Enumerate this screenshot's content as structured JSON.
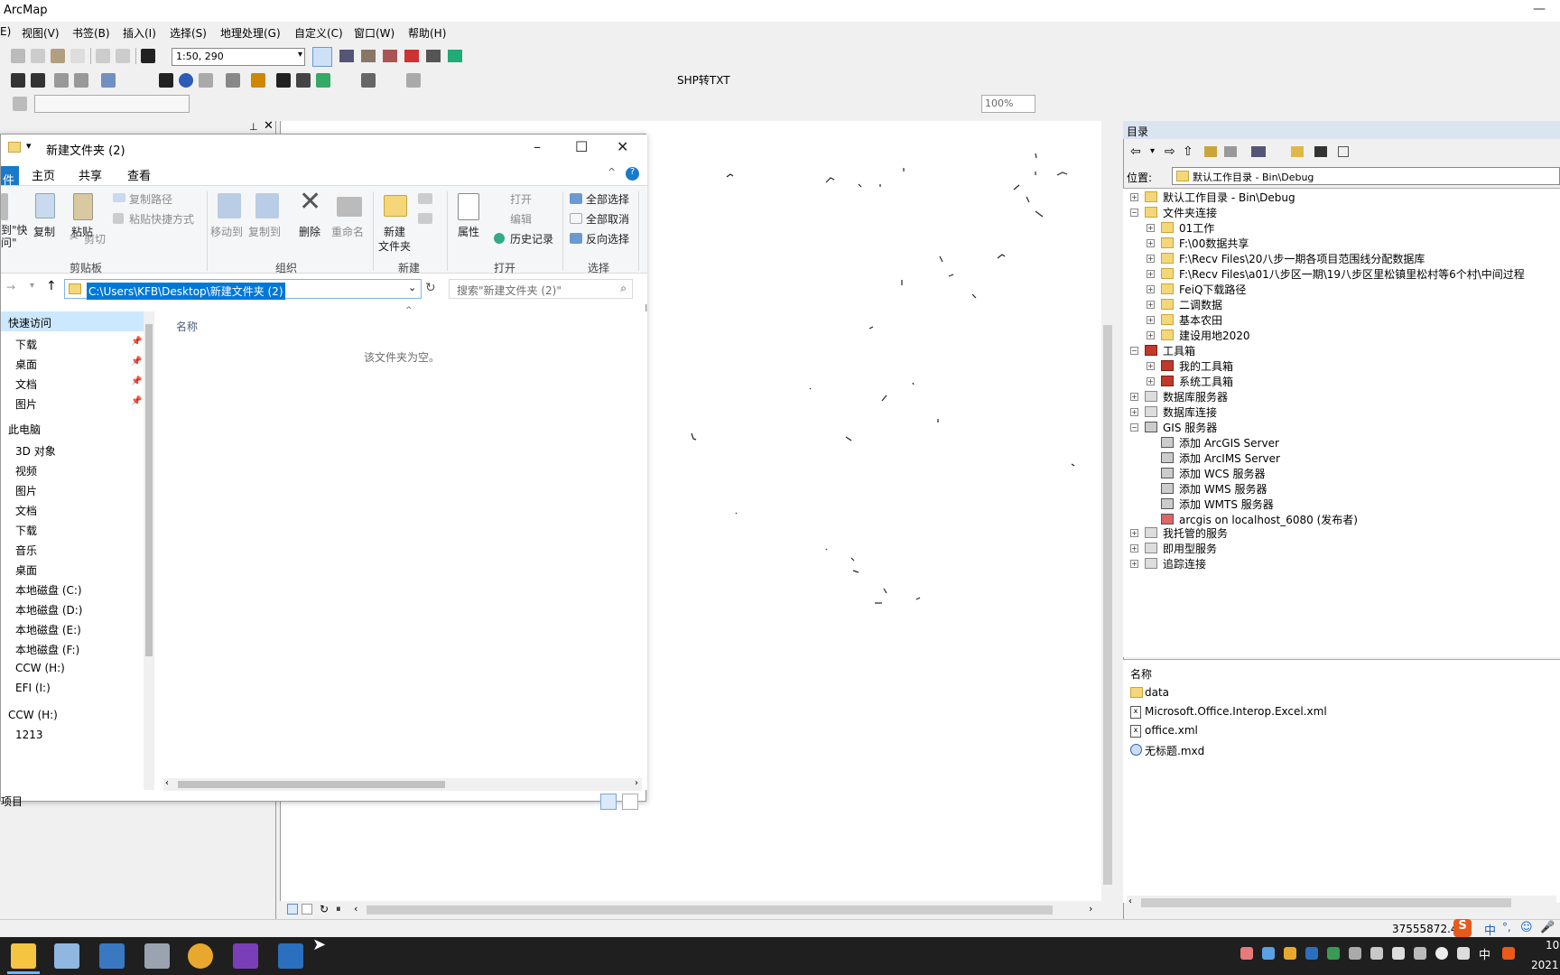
{
  "window": {
    "title": "ArcMap",
    "minimize_glyph": "—"
  },
  "menu": [
    {
      "label": "E)"
    },
    {
      "label": "视图(V)"
    },
    {
      "label": "书签(B)"
    },
    {
      "label": "插入(I)"
    },
    {
      "label": "选择(S)"
    },
    {
      "label": "地理处理(G)"
    },
    {
      "label": "自定义(C)"
    },
    {
      "label": "窗口(W)"
    },
    {
      "label": "帮助(H)"
    }
  ],
  "toolbar": {
    "scale_value": "1:50, 290",
    "shp_button_label": "SHP转TXT",
    "zoom_percent": "100%"
  },
  "explorer": {
    "title": "新建文件夹 (2)",
    "tabs": {
      "file": "件",
      "home": "主页",
      "share": "共享",
      "view": "查看"
    },
    "ribbon": {
      "pin_quick": "到\"快\n问\"",
      "copy": "复制",
      "paste": "粘贴",
      "copy_path": "复制路径",
      "paste_shortcut": "粘贴快捷方式",
      "cut": "剪切",
      "move_to": "移动到",
      "copy_to": "复制到",
      "delete": "删除",
      "rename": "重命名",
      "new_folder_l1": "新建",
      "new_folder_l2": "文件夹",
      "properties": "属性",
      "open": "打开",
      "edit": "编辑",
      "history": "历史记录",
      "select_all": "全部选择",
      "select_none": "全部取消",
      "invert_selection": "反向选择",
      "group_clipboard": "剪贴板",
      "group_organize": "组织",
      "group_new": "新建",
      "group_open": "打开",
      "group_select": "选择"
    },
    "address": "C:\\Users\\KFB\\Desktop\\新建文件夹 (2)",
    "search_placeholder": "搜索\"新建文件夹 (2)\"",
    "column_name": "名称",
    "empty_message": "该文件夹为空。",
    "nav_items": [
      {
        "label": "快速访问"
      },
      {
        "label": "下载"
      },
      {
        "label": "桌面"
      },
      {
        "label": "文档"
      },
      {
        "label": "图片"
      },
      {
        "label": "此电脑"
      },
      {
        "label": "3D 对象"
      },
      {
        "label": "视频"
      },
      {
        "label": "图片"
      },
      {
        "label": "文档"
      },
      {
        "label": "下载"
      },
      {
        "label": "音乐"
      },
      {
        "label": "桌面"
      },
      {
        "label": "本地磁盘 (C:)"
      },
      {
        "label": "本地磁盘 (D:)"
      },
      {
        "label": "本地磁盘 (E:)"
      },
      {
        "label": "本地磁盘 (F:)"
      },
      {
        "label": "CCW (H:)"
      },
      {
        "label": "EFI (I:)"
      },
      {
        "label": "CCW (H:)"
      },
      {
        "label": "1213"
      }
    ],
    "status_text": "项目"
  },
  "catalog": {
    "title": "目录",
    "location_label": "位置:",
    "location_value": "默认工作目录 - Bin\\Debug",
    "tree": [
      {
        "label": "默认工作目录 - Bin\\Debug"
      },
      {
        "label": "文件夹连接"
      },
      {
        "label": "01工作"
      },
      {
        "label": "F:\\00数据共享"
      },
      {
        "label": "F:\\Recv Files\\20八步一期各项目范围线分配数据库"
      },
      {
        "label": "F:\\Recv Files\\a01八步区一期\\19八步区里松镇里松村等6个村\\中间过程"
      },
      {
        "label": "FeiQ下载路径"
      },
      {
        "label": "二调数据"
      },
      {
        "label": "基本农田"
      },
      {
        "label": "建设用地2020"
      },
      {
        "label": "工具箱"
      },
      {
        "label": "我的工具箱"
      },
      {
        "label": "系统工具箱"
      },
      {
        "label": "数据库服务器"
      },
      {
        "label": "数据库连接"
      },
      {
        "label": "GIS 服务器"
      },
      {
        "label": "添加 ArcGIS Server"
      },
      {
        "label": "添加 ArcIMS Server"
      },
      {
        "label": "添加 WCS 服务器"
      },
      {
        "label": "添加 WMS 服务器"
      },
      {
        "label": "添加 WMTS 服务器"
      },
      {
        "label": "arcgis on localhost_6080 (发布者)"
      },
      {
        "label": "我托管的服务"
      },
      {
        "label": "即用型服务"
      },
      {
        "label": "追踪连接"
      }
    ],
    "contents_header": "名称",
    "contents": [
      {
        "label": "data"
      },
      {
        "label": "Microsoft.Office.Interop.Excel.xml"
      },
      {
        "label": "office.xml"
      },
      {
        "label": "无标题.mxd"
      }
    ]
  },
  "status": {
    "coordinates": "37555872.42",
    "ime": "中"
  },
  "taskbar": {
    "clock_line1": "10",
    "clock_line2": "2021",
    "ime": "中"
  },
  "colors": {
    "accent": "#0078d7",
    "file_tab": "#1979ca",
    "catalog_title": "#dbe4f1",
    "taskbar": "#1f1f1f"
  }
}
